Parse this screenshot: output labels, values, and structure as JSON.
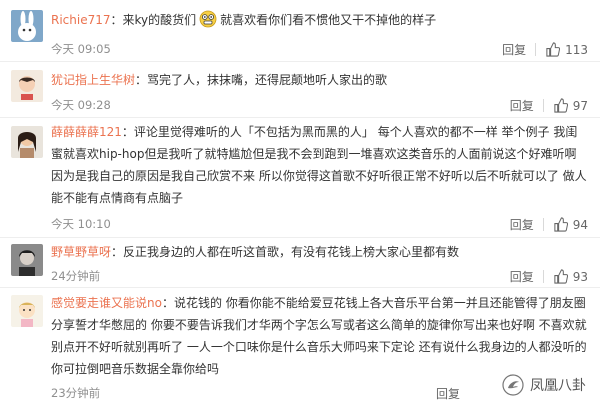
{
  "comments": [
    {
      "name": "Richie717",
      "text_before": "：来ky的酸货们",
      "emoji": "grimace-emoji",
      "text_after": "就喜欢看你们看不惯他又干不掉他的样子",
      "time": "今天 09:05",
      "reply": "回复",
      "likes": "113"
    },
    {
      "name": "犹记指上生华树",
      "text": "：骂完了人，抹抹嘴，还得屁颠地听人家出的歌",
      "time": "今天 09:28",
      "reply": "回复",
      "likes": "97"
    },
    {
      "name": "薛薛薛薛121",
      "text": "：评论里觉得难听的人「不包括为黑而黑的人」 每个人喜欢的都不一样 举个例子 我闺蜜就喜欢hip-hop但是我听了就特尴尬但是我不会到跑到一堆喜欢这类音乐的人面前说这个好难听啊因为是我自己的原因是我自己欣赏不来 所以你觉得这首歌不好听很正常不好听以后不听就可以了 做人能不能有点情商有点脑子",
      "time": "今天 10:10",
      "reply": "回复",
      "likes": "94"
    },
    {
      "name": "野草野草呀",
      "text": "：反正我身边的人都在听这首歌，有没有花钱上榜大家心里都有数",
      "time": "24分钟前",
      "reply": "回复",
      "likes": "93"
    },
    {
      "name": "感觉要走谁又能说no",
      "text": "：说花钱的 你看你能不能给爱豆花钱上各大音乐平台第一并且还能管得了朋友圈分享誓才华憋屈的 你要不要告诉我们才华两个字怎么写或者这么简单的旋律你写出来也好啊 不喜欢就别点开不好听就别再听了 一人一个口味你是什么音乐大师吗来下定论 还有说什么我身边的人都没听的 你可拉倒吧音乐数据全靠你给吗",
      "time": "23分钟前",
      "reply": "回复",
      "likes": ""
    }
  ],
  "watermark": {
    "text": "凤凰八卦",
    "icon": "phoenix-icon"
  },
  "colors": {
    "name": "#eb7350",
    "meta": "#8f8f8f",
    "text": "#333333"
  }
}
